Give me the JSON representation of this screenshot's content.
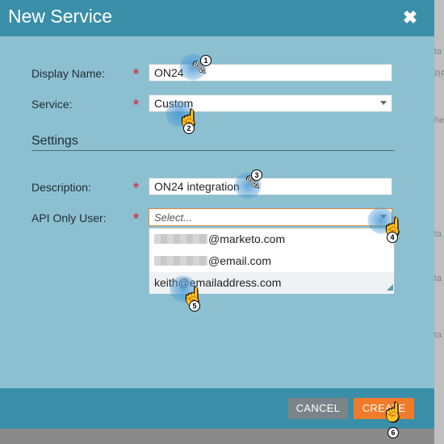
{
  "dialog": {
    "title": "New Service",
    "close_label": "✖"
  },
  "form": {
    "display_name": {
      "label": "Display Name:",
      "value": "ON24"
    },
    "service": {
      "label": "Service:",
      "value": "Custom"
    },
    "settings_title": "Settings",
    "description": {
      "label": "Description:",
      "value": "ON24 integration"
    },
    "api_only_user": {
      "label": "API Only User:",
      "placeholder": "Select..."
    },
    "required_mark": "*"
  },
  "dropdown": {
    "options": [
      {
        "visible_suffix": "@marketo.com"
      },
      {
        "visible_suffix": "@email.com"
      },
      {
        "value": "keith@emailaddress.com"
      }
    ]
  },
  "footer": {
    "cancel_label": "CANCEL",
    "create_label": "CREATE"
  },
  "steps": [
    "1",
    "2",
    "3",
    "4",
    "5",
    "6"
  ],
  "background_fragments": [
    "ta",
    "RR",
    "he",
    "ta",
    "ta",
    "ta"
  ]
}
